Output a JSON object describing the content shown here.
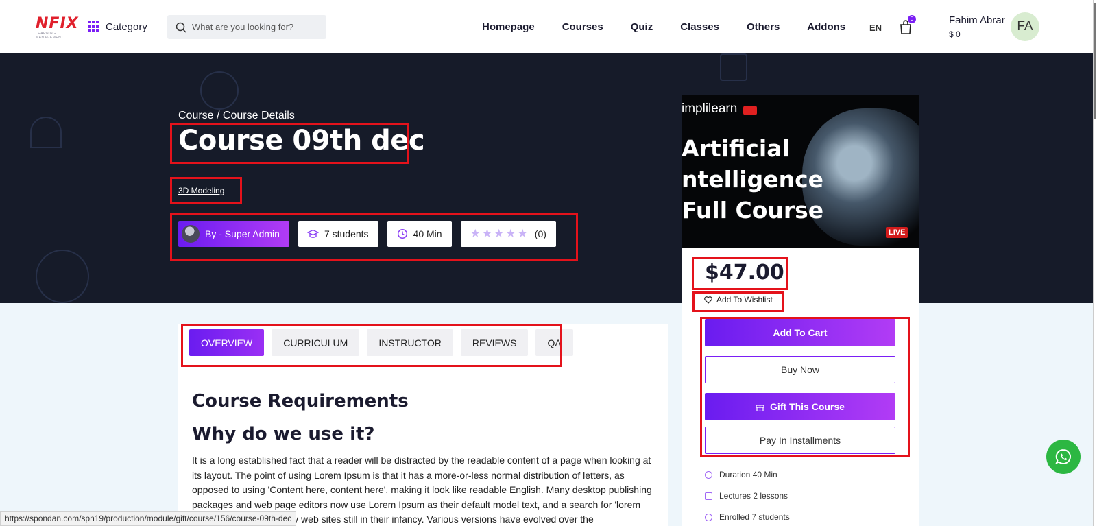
{
  "header": {
    "logo_text": "NFIX",
    "logo_sub": "LEARNING MANAGEMENT",
    "category_label": "Category",
    "search_placeholder": "What are you looking for?",
    "nav": [
      "Homepage",
      "Courses",
      "Quiz",
      "Classes",
      "Others",
      "Addons"
    ],
    "lang": "EN",
    "cart_count": "0",
    "user_name": "Fahim Abrar",
    "user_balance": "$ 0",
    "avatar_initials": "FA"
  },
  "hero": {
    "breadcrumb": "Course / Course Details",
    "title": "Course 09th dec",
    "tag": "3D Modeling",
    "author": "By - Super Admin",
    "students": "7 students",
    "duration": "40 Min",
    "rating_count": "(0)"
  },
  "card": {
    "thumb_brand": "implilearn",
    "thumb_lines": [
      "Artificial",
      "ntelligence",
      "Full Course"
    ],
    "thumb_live": "LIVE",
    "price": "$47.00",
    "wishlist": "Add To Wishlist",
    "add_to_cart": "Add To Cart",
    "buy_now": "Buy Now",
    "gift": "Gift This Course",
    "installments": "Pay In Installments",
    "meta": [
      "Duration 40 Min",
      "Lectures 2 lessons",
      "Enrolled 7 students"
    ]
  },
  "content": {
    "tabs": [
      "OVERVIEW",
      "CURRICULUM",
      "INSTRUCTOR",
      "REVIEWS",
      "QA"
    ],
    "heading": "Course Requirements",
    "subheading": "Why do we use it?",
    "paragraph": "It is a long established fact that a reader will be distracted by the readable content of a page when looking at its layout. The point of using Lorem Ipsum is that it has a more-or-less normal distribution of letters, as opposed to using 'Content here, content here', making it look like readable English. Many desktop publishing packages and web page editors now use Lorem Ipsum as their default model text, and a search for 'lorem ipsum' will uncover many web sites still in their infancy. Various versions have evolved over the"
  },
  "status_url": "https://spondan.com/spn19/production/module/gift/course/156/course-09th-dec",
  "colors": {
    "accent": "#7b1ff5",
    "hero_bg": "#161b29",
    "highlight": "#e4121b"
  }
}
